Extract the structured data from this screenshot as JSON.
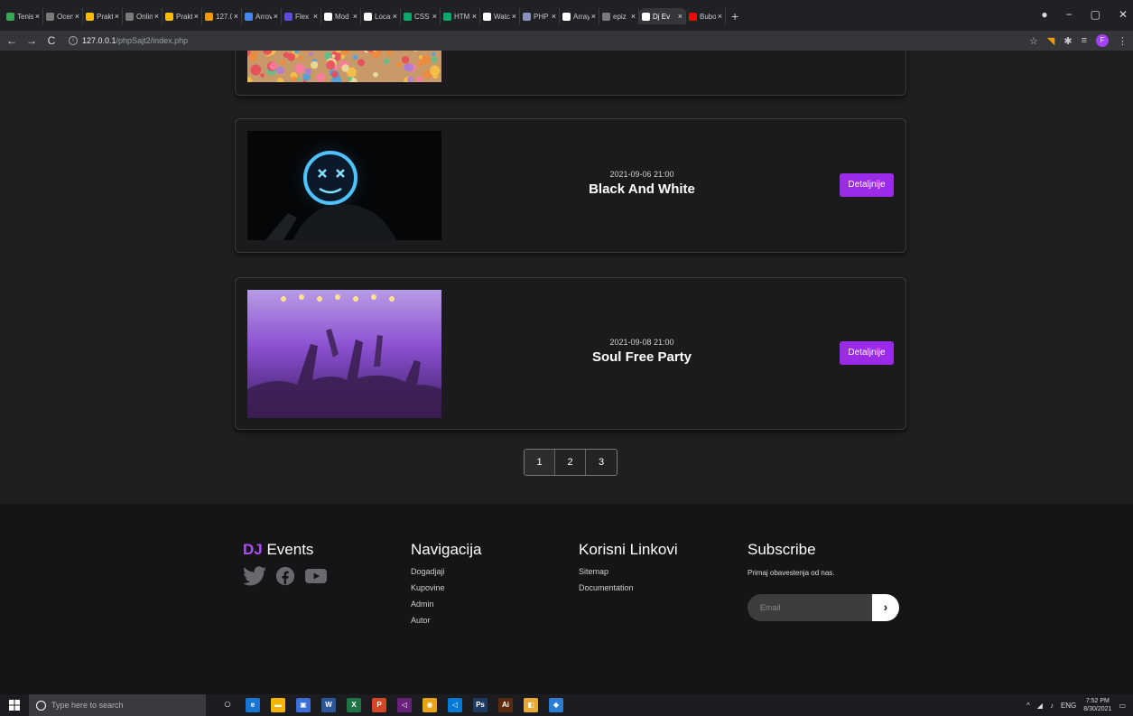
{
  "browser": {
    "tabs": [
      {
        "label": "Tenis",
        "color": "#3aa757"
      },
      {
        "label": "Ocen",
        "color": "#7a7a7a"
      },
      {
        "label": "Prakt",
        "color": "#fbbc04"
      },
      {
        "label": "Onlin",
        "color": "#7a7a7a"
      },
      {
        "label": "Prakt",
        "color": "#fbbc04"
      },
      {
        "label": "127.0",
        "color": "#f29900"
      },
      {
        "label": "Arrov",
        "color": "#4285f4"
      },
      {
        "label": "Flex",
        "color": "#5b4cdb"
      },
      {
        "label": "Mod",
        "color": "#ffffff"
      },
      {
        "label": "Local",
        "color": "#ffffff"
      },
      {
        "label": "CSS",
        "color": "#04aa6d"
      },
      {
        "label": "HTM",
        "color": "#04aa6d"
      },
      {
        "label": "Watc",
        "color": "#ffffff"
      },
      {
        "label": "PHP",
        "color": "#8892bf"
      },
      {
        "label": "Array",
        "color": "#ffffff"
      },
      {
        "label": "epiz",
        "color": "#7a7a7a"
      },
      {
        "label": "Dj Ev",
        "color": "#ffffff",
        "active": true
      },
      {
        "label": "Bubo",
        "color": "#ff0000"
      }
    ],
    "tab_close": "×",
    "new_tab": "+",
    "window_controls": {
      "minimize": "−",
      "restore": "▢",
      "close": "✕"
    },
    "nav": {
      "back": "←",
      "forward": "→",
      "reload": "C"
    },
    "url_host": "127.0.0.1",
    "url_path": "/phpSajt2/index.php",
    "url_info": "i",
    "profile_initial": "F"
  },
  "events": [
    {
      "date": "",
      "title": "",
      "button": "",
      "image": "colorful-dots",
      "partial": true
    },
    {
      "date": "2021-09-06 21:00",
      "title": "Black And White",
      "button": "Detaljnije",
      "image": "neon-mask"
    },
    {
      "date": "2021-09-08 21:00",
      "title": "Soul Free Party",
      "button": "Detaljnije",
      "image": "concert-crowd"
    }
  ],
  "pagination": [
    "1",
    "2",
    "3"
  ],
  "footer": {
    "brand": {
      "dj": "DJ",
      "rest": " Events"
    },
    "social": [
      "twitter-icon",
      "facebook-icon",
      "youtube-icon"
    ],
    "nav": {
      "title": "Navigacija",
      "links": [
        "Dogadjaji",
        "Kupovine",
        "Admin",
        "Autor"
      ]
    },
    "useful": {
      "title": "Korisni Linkovi",
      "links": [
        "Sitemap",
        "Documentation"
      ]
    },
    "subscribe": {
      "title": "Subscribe",
      "text": "Primaj obavestenja od nas.",
      "placeholder": "Email",
      "button": "›"
    }
  },
  "taskbar": {
    "search_placeholder": "Type here to search",
    "apps": [
      {
        "label": "⎔",
        "color": "#1b1c20"
      },
      {
        "label": "e",
        "color": "#1976d2"
      },
      {
        "label": "▬",
        "color": "#f5b400"
      },
      {
        "label": "▣",
        "color": "#3a6fd8"
      },
      {
        "label": "W",
        "color": "#2b579a"
      },
      {
        "label": "X",
        "color": "#217346"
      },
      {
        "label": "P",
        "color": "#d24726"
      },
      {
        "label": "◁",
        "color": "#68217a"
      },
      {
        "label": "◉",
        "color": "#e8a317"
      },
      {
        "label": "◁",
        "color": "#0078d4"
      },
      {
        "label": "Ps",
        "color": "#1e3a5f"
      },
      {
        "label": "Ai",
        "color": "#5a2c0e"
      },
      {
        "label": "◧",
        "color": "#e8a838"
      },
      {
        "label": "◆",
        "color": "#2d7dd2"
      }
    ],
    "tray": {
      "arrow": "^",
      "lang": "ENG",
      "time": "7:52 PM",
      "date": "8/30/2021"
    }
  },
  "colors": {
    "accent": "#9b2be8",
    "brand": "#b04aff",
    "page_bg": "#1f1f21",
    "footer_bg": "#151517"
  }
}
